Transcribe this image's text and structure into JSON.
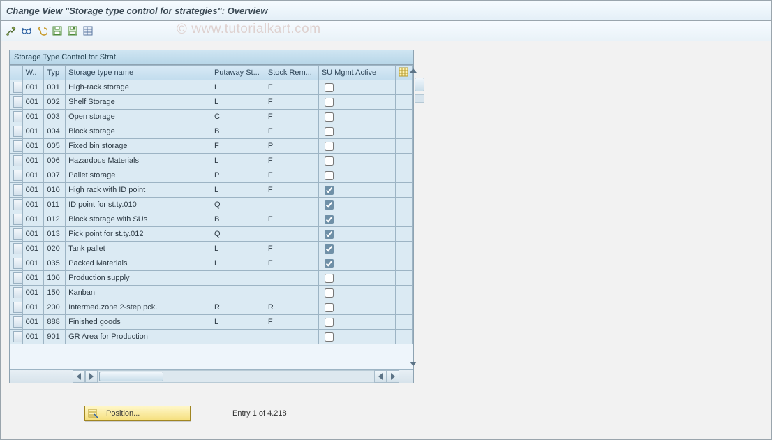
{
  "window": {
    "title": "Change View \"Storage type control for strategies\": Overview"
  },
  "watermark": "www.tutorialkart.com",
  "toolbar_icons": [
    "tools-icon",
    "glasses-icon",
    "undo-icon",
    "save-variant-icon",
    "save-icon",
    "layout-icon"
  ],
  "panel": {
    "title": "Storage Type Control for Strat."
  },
  "columns": {
    "w": "W..",
    "typ": "Typ",
    "name": "Storage type name",
    "putaway": "Putaway St...",
    "stockrem": "Stock Rem...",
    "su": "SU Mgmt Active"
  },
  "rows": [
    {
      "w": "001",
      "typ": "001",
      "name": "High-rack storage",
      "put": "L",
      "rem": "F",
      "su": false
    },
    {
      "w": "001",
      "typ": "002",
      "name": "Shelf Storage",
      "put": "L",
      "rem": "F",
      "su": false
    },
    {
      "w": "001",
      "typ": "003",
      "name": "Open storage",
      "put": "C",
      "rem": "F",
      "su": false
    },
    {
      "w": "001",
      "typ": "004",
      "name": "Block storage",
      "put": "B",
      "rem": "F",
      "su": false
    },
    {
      "w": "001",
      "typ": "005",
      "name": "Fixed bin storage",
      "put": "F",
      "rem": "P",
      "su": false
    },
    {
      "w": "001",
      "typ": "006",
      "name": "Hazardous Materials",
      "put": "L",
      "rem": "F",
      "su": false
    },
    {
      "w": "001",
      "typ": "007",
      "name": "Pallet storage",
      "put": "P",
      "rem": "F",
      "su": false
    },
    {
      "w": "001",
      "typ": "010",
      "name": "High rack with ID point",
      "put": "L",
      "rem": "F",
      "su": true
    },
    {
      "w": "001",
      "typ": "011",
      "name": "ID point for st.ty.010",
      "put": "Q",
      "rem": "",
      "su": true
    },
    {
      "w": "001",
      "typ": "012",
      "name": "Block storage with SUs",
      "put": "B",
      "rem": "F",
      "su": true
    },
    {
      "w": "001",
      "typ": "013",
      "name": "Pick point for st.ty.012",
      "put": "Q",
      "rem": "",
      "su": true
    },
    {
      "w": "001",
      "typ": "020",
      "name": "Tank pallet",
      "put": "L",
      "rem": "F",
      "su": true
    },
    {
      "w": "001",
      "typ": "035",
      "name": "Packed Materials",
      "put": "L",
      "rem": "F",
      "su": true
    },
    {
      "w": "001",
      "typ": "100",
      "name": "Production supply",
      "put": "",
      "rem": "",
      "su": false
    },
    {
      "w": "001",
      "typ": "150",
      "name": "Kanban",
      "put": "",
      "rem": "",
      "su": false
    },
    {
      "w": "001",
      "typ": "200",
      "name": "Intermed.zone 2-step pck.",
      "put": "R",
      "rem": "R",
      "su": false
    },
    {
      "w": "001",
      "typ": "888",
      "name": "Finished goods",
      "put": "L",
      "rem": "F",
      "su": false
    },
    {
      "w": "001",
      "typ": "901",
      "name": "GR Area for Production",
      "put": "",
      "rem": "",
      "su": false
    }
  ],
  "footer": {
    "position_label": "Position...",
    "entry_text": "Entry 1 of 4.218"
  }
}
